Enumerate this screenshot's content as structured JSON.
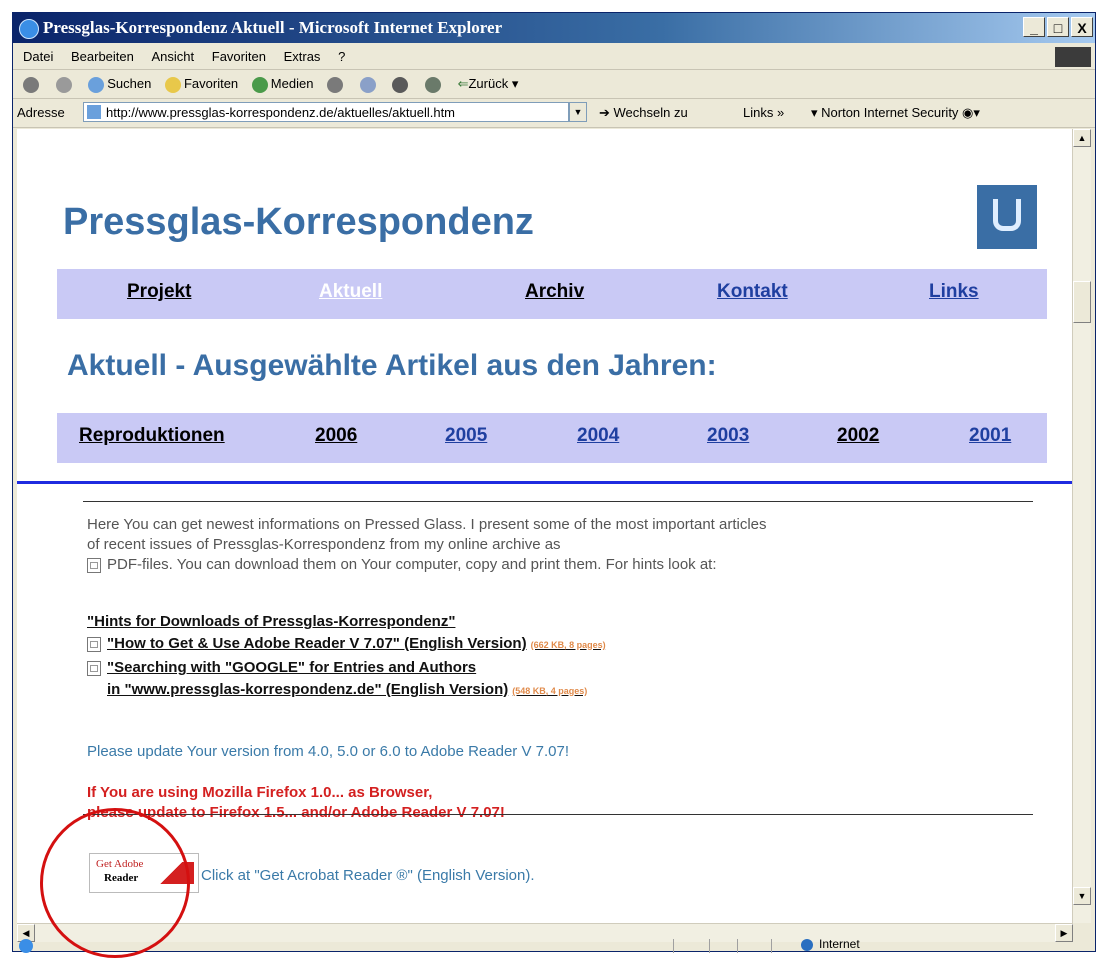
{
  "window": {
    "title": "Pressglas-Korrespondenz Aktuell - Microsoft Internet Explorer",
    "minimize": "_",
    "restore": "□",
    "close": "X"
  },
  "menu": [
    "Datei",
    "Bearbeiten",
    "Ansicht",
    "Favoriten",
    "Extras",
    "?"
  ],
  "toolbar": {
    "search": "Suchen",
    "favorites": "Favoriten",
    "media": "Medien",
    "back": "Zurück"
  },
  "address": {
    "label": "Adresse",
    "url": "http://www.pressglas-korrespondenz.de/aktuelles/aktuell.htm",
    "go": "Wechseln zu",
    "links": "Links",
    "norton": "Norton Internet Security"
  },
  "page": {
    "site_title": "Pressglas-Korrespondenz",
    "nav": [
      {
        "label": "Projekt",
        "color": "#000000"
      },
      {
        "label": "Aktuell",
        "color": "#ffffff"
      },
      {
        "label": "Archiv",
        "color": "#000000"
      },
      {
        "label": "Kontakt",
        "color": "#1f3fa0"
      },
      {
        "label": "Links",
        "color": "#1f3fa0"
      }
    ],
    "heading": "Aktuell - Ausgewählte Artikel aus den Jahren:",
    "years": [
      "Reproduktionen",
      "2006",
      "2005",
      "2004",
      "2003",
      "2002",
      "2001"
    ],
    "intro_line1": "Here You can get newest informations on Pressed Glass. I present some of the most important articles",
    "intro_line2": "of recent issues of Pressglas-Korrespondenz from my online archive as",
    "intro_line3": "PDF-files. You can download them on Your computer, copy and print them. For hints look at:",
    "hints_link": "\"Hints for Downloads of Pressglas-Korrespondenz\"",
    "adobe_link": "\"How to Get & Use Adobe Reader V 7.07\" (English Version)",
    "adobe_size": "(662 KB, 8 pages)",
    "google_link1": "\"Searching with \"GOOGLE\" for Entries and Authors",
    "google_link2": "in \"www.pressglas-korrespondenz.de\" (English Version)",
    "google_size": "(548 KB, 4 pages)",
    "update_text": "Please update Your version from 4.0, 5.0 or 6.0 to Adobe Reader V 7.07!",
    "warn1": "If You are using Mozilla Firefox 1.0... as Browser,",
    "warn2": "please update to Firefox 1.5... and/or Adobe Reader V 7.07!",
    "badge_get": "Get Adobe",
    "badge_reader": "Reader",
    "click_text": "Click at \"Get Acrobat Reader ®\" (English Version)."
  },
  "status": {
    "zone": "Internet"
  }
}
